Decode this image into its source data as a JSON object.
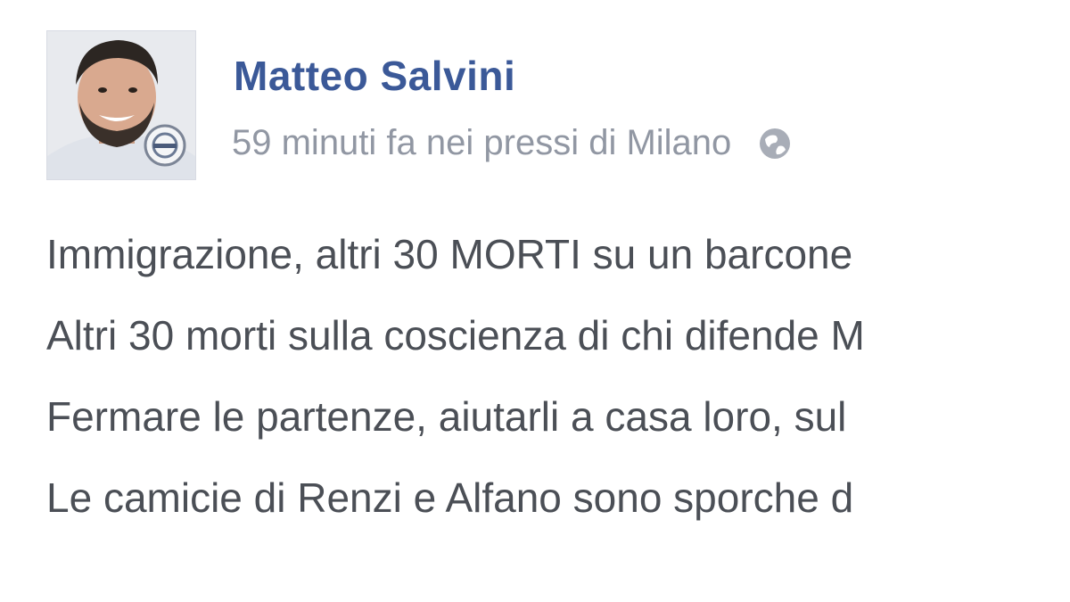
{
  "post": {
    "author": "Matteo Salvini",
    "meta": "59 minuti fa nei pressi di Milano",
    "privacy_icon": "globe-icon",
    "lines": [
      "Immigrazione, altri 30 MORTI su un barcone",
      "Altri 30 morti sulla coscienza di chi difende M",
      "Fermare le partenze, aiutarli a casa loro, sul",
      "Le camicie di Renzi e Alfano sono sporche d"
    ]
  },
  "colors": {
    "author": "#3b5998",
    "meta": "#9197a3",
    "body_text": "#4b4f56",
    "background": "#ffffff"
  }
}
